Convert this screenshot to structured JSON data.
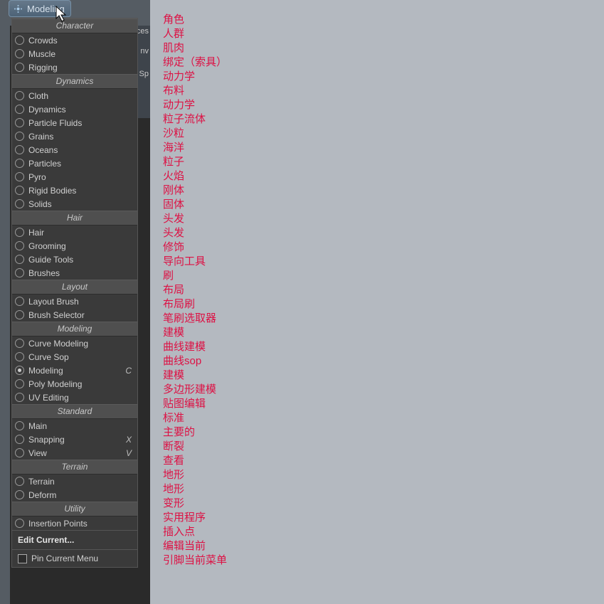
{
  "header": {
    "button_label": "Modeling"
  },
  "bg_peek": {
    "txt1": "nv",
    "txt2": "Sp",
    "txt3": "ces"
  },
  "sections": [
    {
      "title": "Character",
      "items": [
        {
          "label": "Crowds"
        },
        {
          "label": "Muscle"
        },
        {
          "label": "Rigging"
        }
      ]
    },
    {
      "title": "Dynamics",
      "items": [
        {
          "label": "Cloth"
        },
        {
          "label": "Dynamics"
        },
        {
          "label": "Particle Fluids"
        },
        {
          "label": "Grains"
        },
        {
          "label": "Oceans"
        },
        {
          "label": "Particles"
        },
        {
          "label": "Pyro"
        },
        {
          "label": "Rigid Bodies"
        },
        {
          "label": "Solids"
        }
      ]
    },
    {
      "title": "Hair",
      "items": [
        {
          "label": "Hair"
        },
        {
          "label": "Grooming"
        },
        {
          "label": "Guide Tools"
        },
        {
          "label": "Brushes"
        }
      ]
    },
    {
      "title": "Layout",
      "items": [
        {
          "label": "Layout Brush"
        },
        {
          "label": "Brush Selector"
        }
      ]
    },
    {
      "title": "Modeling",
      "items": [
        {
          "label": "Curve Modeling"
        },
        {
          "label": "Curve Sop"
        },
        {
          "label": "Modeling",
          "selected": true,
          "shortcut": "C"
        },
        {
          "label": "Poly Modeling"
        },
        {
          "label": "UV Editing"
        }
      ]
    },
    {
      "title": "Standard",
      "items": [
        {
          "label": "Main"
        },
        {
          "label": "Snapping",
          "shortcut": "X"
        },
        {
          "label": "View",
          "shortcut": "V"
        }
      ]
    },
    {
      "title": "Terrain",
      "items": [
        {
          "label": "Terrain"
        },
        {
          "label": "Deform"
        }
      ]
    },
    {
      "title": "Utility",
      "items": [
        {
          "label": "Insertion Points"
        }
      ]
    }
  ],
  "footer": {
    "edit_label": "Edit Current...",
    "pin_label": "Pin Current Menu"
  },
  "translations": [
    "角色",
    "人群",
    "肌肉",
    "绑定（索具）",
    "动力学",
    "布料",
    "动力学",
    "粒子流体",
    "沙粒",
    "海洋",
    "粒子",
    "火焰",
    "刚体",
    "固体",
    "头发",
    "头发",
    "修饰",
    "导向工具",
    "刷",
    "布局",
    "布局刷",
    "笔刷选取器",
    "建模",
    "曲线建模",
    "曲线sop",
    "建模",
    "多边形建模",
    "贴图编辑",
    "标准",
    "主要的",
    "断裂",
    "查看",
    "地形",
    "地形",
    "变形",
    "实用程序",
    "插入点",
    "编辑当前",
    "引脚当前菜单"
  ]
}
